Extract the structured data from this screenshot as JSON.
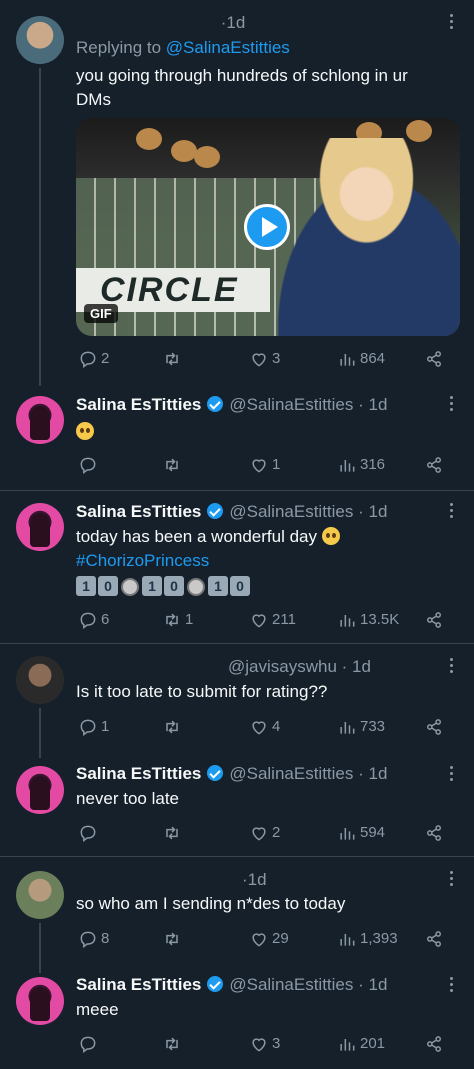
{
  "tweets": [
    {
      "time": "1d",
      "replying_prefix": "Replying to ",
      "replying_handle": "@SalinaEstitties",
      "text": "you going through hundreds of schlong in ur DMs",
      "media_badge": "GIF",
      "media_sign": "CIRCLE",
      "replies": "2",
      "retweets": "",
      "likes": "3",
      "views": "864"
    },
    {
      "name": "Salina EsTitties",
      "handle": "@SalinaEstitties",
      "time": "1d",
      "replies": "",
      "retweets": "",
      "likes": "1",
      "views": "316"
    },
    {
      "name": "Salina EsTitties",
      "handle": "@SalinaEstitties",
      "time": "1d",
      "text": "today has been a wonderful day",
      "hashtag": "#ChorizoPrincess",
      "keycaps": [
        "1",
        "0",
        "",
        "1",
        "0",
        "",
        "1",
        "0"
      ],
      "replies": "6",
      "retweets": "1",
      "likes": "211",
      "views": "13.5K"
    },
    {
      "handle": "@javisayswhu",
      "time": "1d",
      "text": "Is it too late to submit for rating??",
      "replies": "1",
      "retweets": "",
      "likes": "4",
      "views": "733"
    },
    {
      "name": "Salina EsTitties",
      "handle": "@SalinaEstitties",
      "time": "1d",
      "text": "never too late",
      "replies": "",
      "retweets": "",
      "likes": "2",
      "views": "594"
    },
    {
      "time": "1d",
      "text": "so who am I sending n*des to today",
      "replies": "8",
      "retweets": "",
      "likes": "29",
      "views": "1,393"
    },
    {
      "name": "Salina EsTitties",
      "handle": "@SalinaEstitties",
      "time": "1d",
      "text": "meee",
      "replies": "",
      "retweets": "",
      "likes": "3",
      "views": "201"
    }
  ],
  "separator": "·",
  "icons": {
    "reply": "reply-icon",
    "retweet": "retweet-icon",
    "like": "heart-icon",
    "views": "views-icon",
    "share": "share-icon",
    "more": "more-icon",
    "verified": "verified-badge-icon"
  },
  "accent": "#1d9bf0"
}
